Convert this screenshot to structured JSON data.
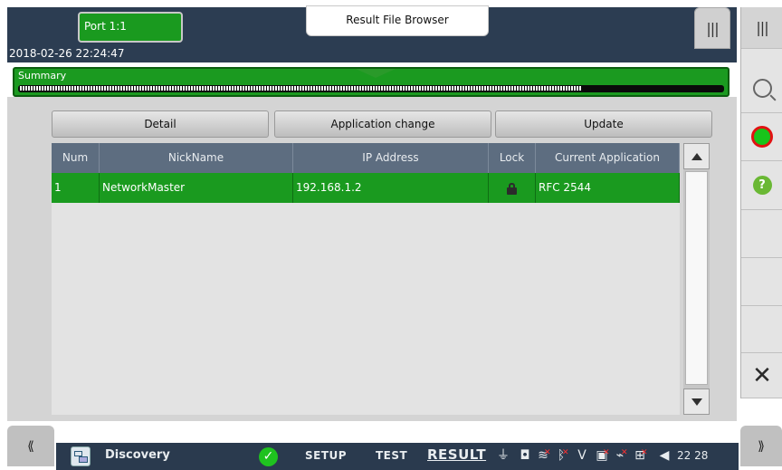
{
  "header": {
    "port_tab": "Port 1:1",
    "datetime": "2018-02-26 22:24:47",
    "file_browser_tab": "Result File Browser",
    "top_right_icon": "triple-bars-icon"
  },
  "summary": {
    "label": "Summary",
    "progress_fraction": 0.8
  },
  "toolbar": {
    "detail_label": "Detail",
    "application_change_label": "Application change",
    "update_label": "Update"
  },
  "table": {
    "columns": [
      "Num",
      "NickName",
      "IP Address",
      "Lock",
      "Current Application"
    ],
    "rows": [
      {
        "num": "1",
        "nickname": "NetworkMaster",
        "ip": "192.168.1.2",
        "lock_icon": "lock-icon",
        "application": "RFC 2544"
      }
    ]
  },
  "right_sidebar": {
    "icons": [
      "triple-bars-icon",
      "search-icon",
      "record-icon",
      "help-icon",
      "close-icon"
    ],
    "help_glyph": "?",
    "close_glyph": "✕"
  },
  "bottom_bar": {
    "left_tab_glyph": "⟪",
    "right_tab_glyph": "⟫",
    "app_name": "Discovery",
    "tabs": [
      "SETUP",
      "TEST",
      "RESULT"
    ],
    "active_tab": "RESULT",
    "clock": "22 28",
    "status_icons": [
      "plug-icon",
      "window-icon",
      "wifi-icon",
      "bluetooth-icon",
      "v-icon",
      "terminal-icon",
      "satellite-icon",
      "network-icon",
      "speaker-icon"
    ]
  },
  "colors": {
    "accent_green": "#1a9a1f",
    "header_navy": "#2c3d52",
    "table_header": "#5d6d80"
  }
}
